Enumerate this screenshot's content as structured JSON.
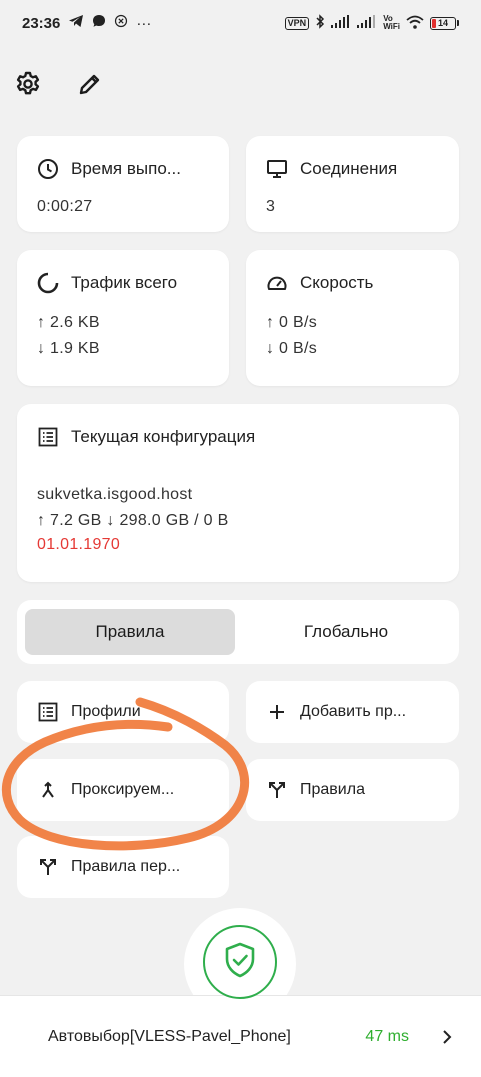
{
  "status_bar": {
    "time": "23:36",
    "dots": "···",
    "vpn_badge": "VPN",
    "vowifi_top": "Vo",
    "vowifi_bottom": "WiFi",
    "battery": "14"
  },
  "stats": {
    "uptime": {
      "label": "Время выпо...",
      "value": "0:00:27"
    },
    "connections": {
      "label": "Соединения",
      "value": "3"
    },
    "traffic": {
      "label": "Трафик всего",
      "up": "↑ 2.6 KB",
      "down": "↓ 1.9 KB"
    },
    "speed": {
      "label": "Скорость",
      "up": "↑ 0 B/s",
      "down": "↓ 0 B/s"
    }
  },
  "config": {
    "label": "Текущая конфигурация",
    "host": "sukvetka.isgood.host",
    "usage": "↑ 7.2 GB ↓ 298.0 GB / 0 B",
    "expire": "01.01.1970"
  },
  "mode": {
    "rules": "Правила",
    "global": "Глобально",
    "selected": "rules"
  },
  "tiles": {
    "profiles": "Профили",
    "add_profile": "Добавить пр...",
    "proxied": "Проксируем...",
    "rules": "Правила",
    "override_rules": "Правила пер..."
  },
  "bottom": {
    "proxy_name": "Автовыбор[VLESS-Pavel_Phone]",
    "latency": "47 ms"
  },
  "colors": {
    "accent_green": "#2fae4c",
    "latency_green": "#2fae2f",
    "expire_red": "#e53935",
    "scribble_orange": "#f07a3a"
  }
}
